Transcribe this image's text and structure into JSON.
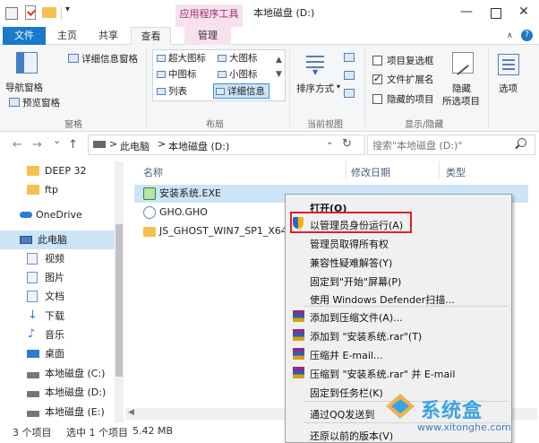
{
  "window": {
    "context_tab_label": "应用程序工具",
    "title": "本地磁盘 (D:)",
    "minimize": "—",
    "close": "✕"
  },
  "quick_access": {
    "dropdown": "▾"
  },
  "tabs": {
    "file": "文件",
    "home": "主页",
    "share": "共享",
    "view": "查看",
    "manage": "管理",
    "collapse": "∧",
    "help": "?"
  },
  "ribbon": {
    "panes": {
      "navigation_pane": "导航窗格",
      "preview_pane": "预览窗格",
      "details_pane": "详细信息窗格",
      "group": "窗格"
    },
    "layout": {
      "xl_icons": "超大图标",
      "large_icons": "大图标",
      "medium_icons": "中图标",
      "small_icons": "小图标",
      "list": "列表",
      "details": "详细信息",
      "group": "布局"
    },
    "current_view": {
      "sort_by": "排序方式",
      "group": "当前视图"
    },
    "show_hide": {
      "item_checkboxes": "项目复选框",
      "file_extensions": "文件扩展名",
      "hidden_items": "隐藏的项目",
      "hide_selected_line1": "隐藏",
      "hide_selected_line2": "所选项目",
      "options": "选项",
      "group": "显示/隐藏"
    }
  },
  "addressbar": {
    "back": "←",
    "forward": "→",
    "up_dropdown": "⌄",
    "up": "↑",
    "path": [
      "此电脑",
      "本地磁盘 (D:)"
    ],
    "chev": ">",
    "refresh": "↻",
    "search_placeholder": "搜索\"本地磁盘 (D:)\""
  },
  "nav": {
    "items": [
      {
        "label": "DEEP 32"
      },
      {
        "label": "ftp"
      },
      {
        "label": "OneDrive"
      },
      {
        "label": "此电脑"
      },
      {
        "label": "视频"
      },
      {
        "label": "图片"
      },
      {
        "label": "文档"
      },
      {
        "label": "下载"
      },
      {
        "label": "音乐"
      },
      {
        "label": "桌面"
      },
      {
        "label": "本地磁盘 (C:)"
      },
      {
        "label": "本地磁盘 (D:)"
      },
      {
        "label": "本地磁盘 (E:)"
      }
    ]
  },
  "content": {
    "columns": {
      "name": "名称",
      "modified": "修改日期",
      "type": "类型"
    },
    "files": [
      {
        "name": "安装系统.EXE"
      },
      {
        "name": "GHO.GHO"
      },
      {
        "name": "JS_GHOST_WIN7_SP1_X64_"
      }
    ]
  },
  "status": {
    "item_count": "3 个项目",
    "selected": "选中 1 个项目",
    "size": "5.42 MB"
  },
  "context_menu": {
    "items": [
      "打开(O)",
      "以管理员身份运行(A)",
      "管理员取得所有权",
      "兼容性疑难解答(Y)",
      "固定到\"开始\"屏幕(P)",
      "使用 Windows Defender扫描...",
      "添加到压缩文件(A)...",
      "添加到 \"安装系统.rar\"(T)",
      "压缩并 E-mail...",
      "压缩到 \"安装系统.rar\" 并 E-mail",
      "固定到任务栏(K)",
      "通过QQ发送到",
      "还原以前的版本(V)"
    ]
  },
  "watermark": {
    "title": "系统盒",
    "url": "www.xitonghe.com"
  },
  "colors": {
    "accent": "#1979ca",
    "selection": "#cce4f7",
    "context_tab": "#f7e1ee",
    "highlight_box": "#e02020"
  }
}
